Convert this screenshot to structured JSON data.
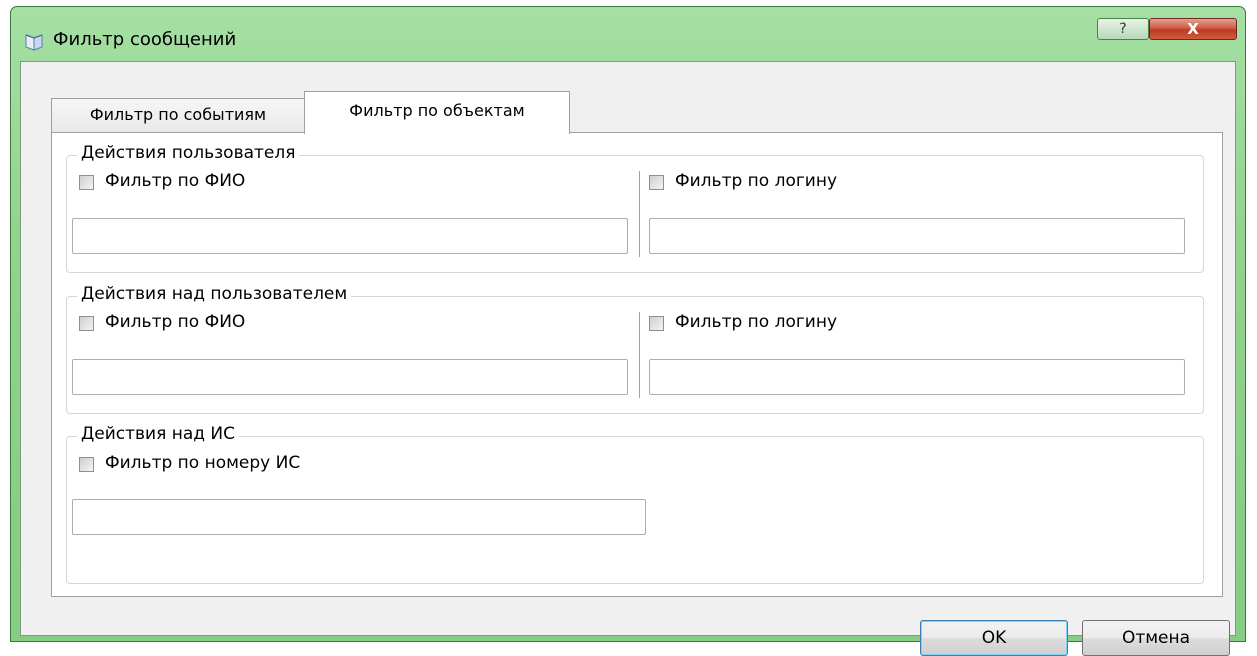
{
  "window": {
    "title": "Фильтр сообщений",
    "help_label": "?",
    "close_label": "X"
  },
  "tabs": [
    {
      "label": "Фильтр по событиям",
      "selected": false
    },
    {
      "label": "Фильтр по объектам",
      "selected": true
    }
  ],
  "groups": {
    "user_actions": {
      "title": "Действия пользователя",
      "fio_label": "Фильтр по ФИО",
      "fio_value": "",
      "login_label": "Фильтр по логину",
      "login_value": ""
    },
    "actions_on_user": {
      "title": "Действия над пользователем",
      "fio_label": "Фильтр по ФИО",
      "fio_value": "",
      "login_label": "Фильтр по логину",
      "login_value": ""
    },
    "actions_on_is": {
      "title": "Действия над ИС",
      "number_label": "Фильтр по номеру ИС",
      "number_value": ""
    }
  },
  "buttons": {
    "ok": "OK",
    "cancel": "Отмена"
  },
  "colors": {
    "title_bar": "#8fd38c",
    "close_button": "#c7462c",
    "client_bg": "#f0f0f0",
    "ok_border": "#3c7fb1"
  }
}
